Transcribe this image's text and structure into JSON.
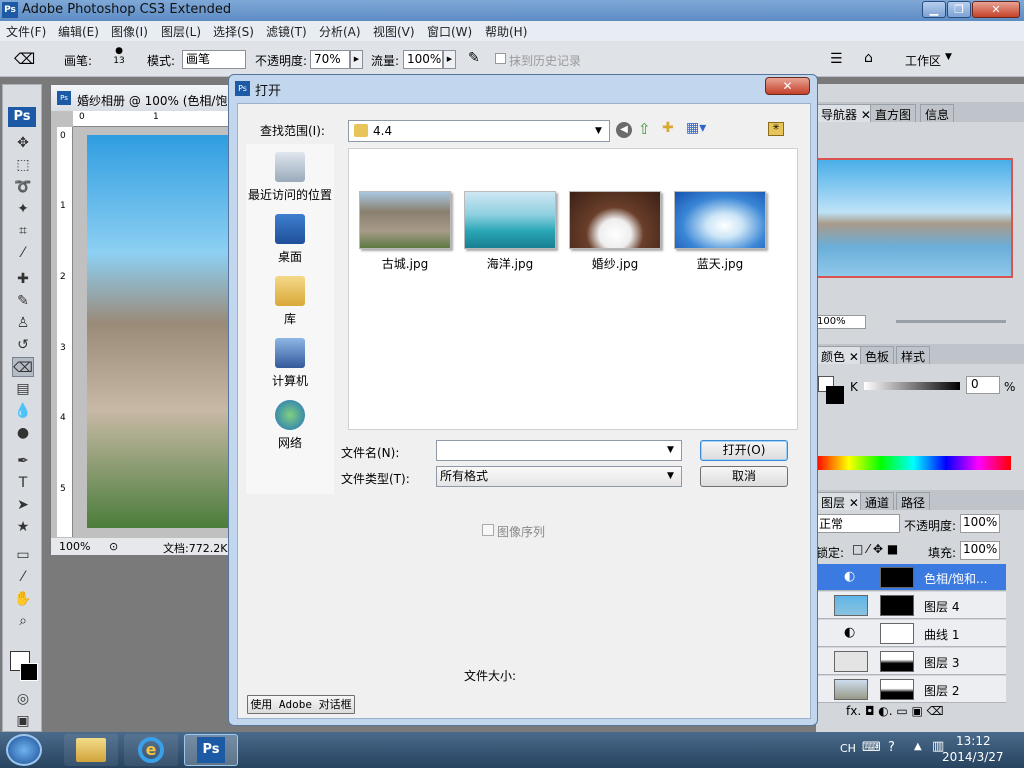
{
  "app": {
    "title": "Adobe Photoshop CS3 Extended",
    "logo": "Ps"
  },
  "menu": [
    "文件(F)",
    "编辑(E)",
    "图像(I)",
    "图层(L)",
    "选择(S)",
    "滤镜(T)",
    "分析(A)",
    "视图(V)",
    "窗口(W)",
    "帮助(H)"
  ],
  "options": {
    "brush_label": "画笔:",
    "brush_size": "13",
    "mode_label": "模式:",
    "mode_value": "画笔",
    "opacity_label": "不透明度:",
    "opacity_value": "70%",
    "flow_label": "流量:",
    "flow_value": "100%",
    "history_label": "抹到历史记录",
    "workspace_label": "工作区"
  },
  "document": {
    "title": "婚纱相册 @ 100% (色相/饱",
    "zoom": "100%",
    "doc_size": "文档:772.2K",
    "ruler_top": [
      "0",
      "1"
    ],
    "ruler_left": [
      "0",
      "1",
      "2",
      "3",
      "4",
      "5"
    ]
  },
  "panels": {
    "nav_tabs": [
      "导航器",
      "直方图",
      "信息"
    ],
    "nav_zoom": "100%",
    "color_tabs": [
      "颜色",
      "色板",
      "样式"
    ],
    "color_k_label": "K",
    "color_k_value": "0",
    "color_k_unit": "%",
    "layer_tabs": [
      "图层",
      "通道",
      "路径"
    ],
    "blend_mode": "正常",
    "opacity_label": "不透明度:",
    "opacity_value": "100%",
    "lock_label": "锁定:",
    "fill_label": "填充:",
    "fill_value": "100%",
    "layers": [
      "色相/饱和...",
      "图层 4",
      "曲线 1",
      "图层 3",
      "图层 2"
    ]
  },
  "dialog": {
    "title": "打开",
    "lookin_label": "查找范围(I):",
    "lookin_value": "4.4",
    "places": [
      "最近访问的位置",
      "桌面",
      "库",
      "计算机",
      "网络"
    ],
    "files": [
      "古城.jpg",
      "海洋.jpg",
      "婚纱.jpg",
      "蓝天.jpg"
    ],
    "filename_label": "文件名(N):",
    "filename_value": "",
    "filetype_label": "文件类型(T):",
    "filetype_value": "所有格式",
    "open_label": "打开(O)",
    "cancel_label": "取消",
    "image_sequence_label": "图像序列",
    "filesize_label": "文件大小:",
    "adobe_dialog_label": "使用 Adobe 对话框"
  },
  "taskbar": {
    "lang": "CH",
    "time": "13:12",
    "date": "2014/3/27"
  }
}
